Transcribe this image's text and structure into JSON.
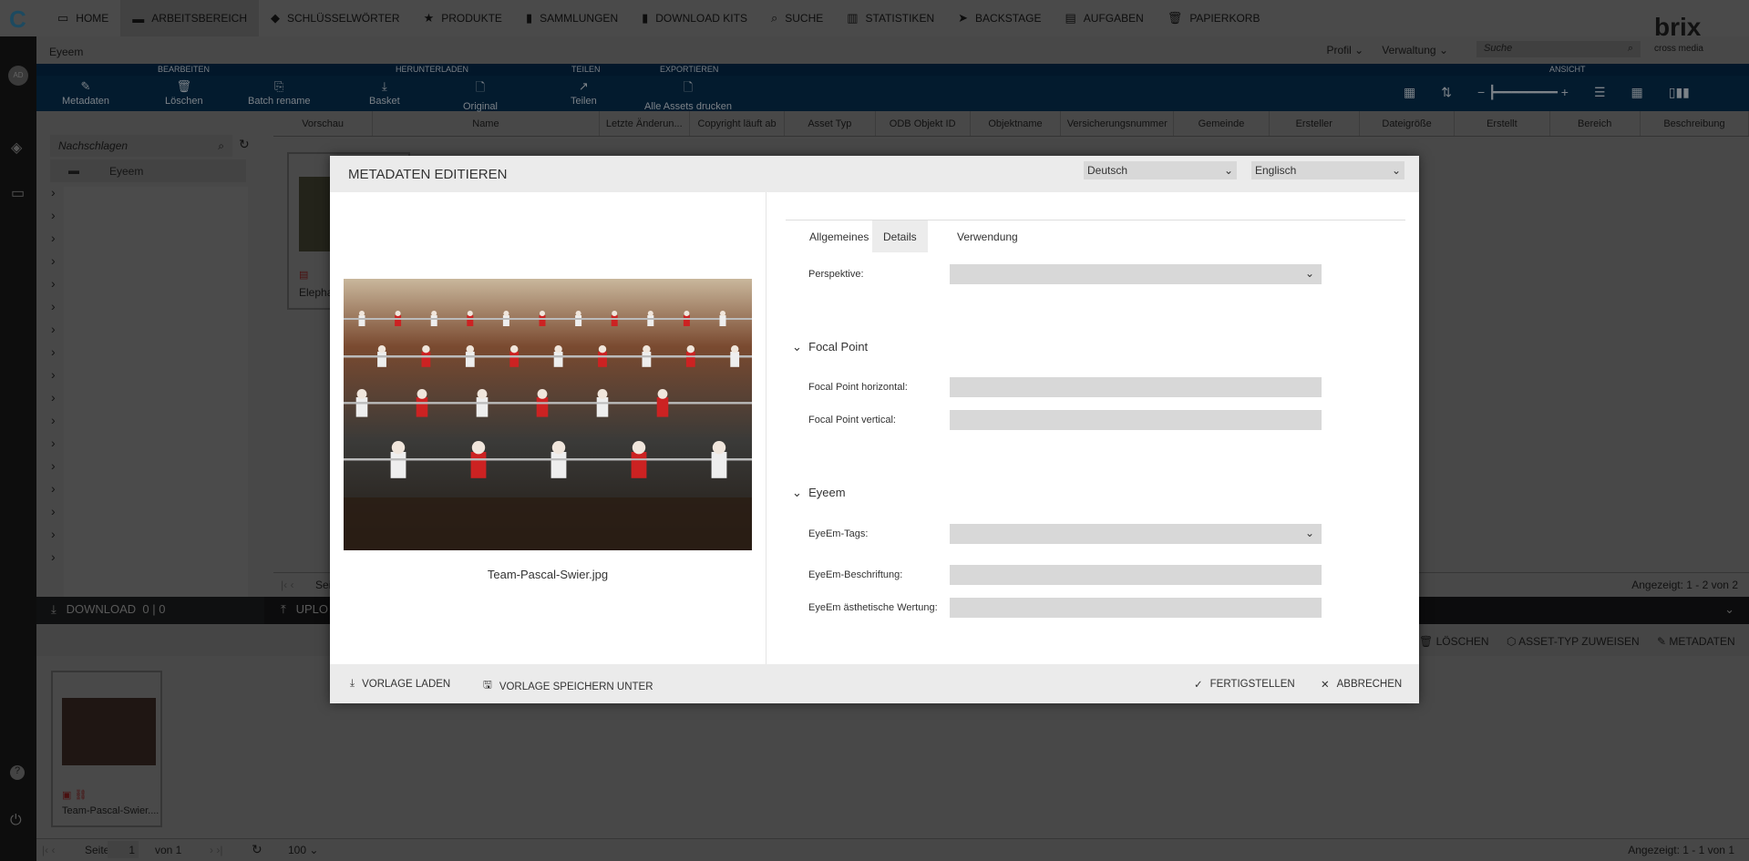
{
  "nav": {
    "items": [
      {
        "label": "HOME",
        "icon": "monitor-icon"
      },
      {
        "label": "ARBEITSBEREICH",
        "icon": "folder-icon",
        "active": true
      },
      {
        "label": "SCHLÜSSELWÖRTER",
        "icon": "tag-icon"
      },
      {
        "label": "PRODUKTE",
        "icon": "star-icon"
      },
      {
        "label": "SAMMLUNGEN",
        "icon": "briefcase-icon"
      },
      {
        "label": "DOWNLOAD KITS",
        "icon": "briefcase-icon"
      },
      {
        "label": "SUCHE",
        "icon": "search-icon"
      },
      {
        "label": "STATISTIKEN",
        "icon": "bar-chart-icon"
      },
      {
        "label": "BACKSTAGE",
        "icon": "send-icon"
      },
      {
        "label": "AUFGABEN",
        "icon": "clipboard-icon"
      },
      {
        "label": "PAPIERKORB",
        "icon": "trash-icon"
      }
    ],
    "profile": "Profil",
    "admin": "Verwaltung",
    "search_placeholder": "Suche",
    "brand": "brix",
    "brand_sub": "cross media",
    "avatar": "AD"
  },
  "breadcrumb": "Eyeem",
  "ribbon": {
    "groups": [
      "BEARBEITEN",
      "HERUNTERLADEN",
      "TEILEN",
      "EXPORTIEREN",
      "ANSICHT"
    ],
    "buttons": [
      "Metadaten",
      "Löschen",
      "Batch rename",
      "Basket",
      "Original",
      "Teilen",
      "Alle Assets drucken"
    ]
  },
  "columns": [
    "Vorschau",
    "Name",
    "Letzte Änderun...",
    "Copyright läuft ab",
    "Asset Typ",
    "ODB Objekt ID",
    "Objektname",
    "Versicherungsnummer",
    "Gemeinde",
    "Ersteller",
    "Dateigröße",
    "Erstellt",
    "Bereich",
    "Beschreibung"
  ],
  "left_panel": {
    "search_placeholder": "Nachschlagen",
    "root": "Eyeem"
  },
  "grid": {
    "card_name": "Elepha",
    "pager_label": "Sei",
    "shown": "Angezeigt: 1 - 2 von 2"
  },
  "bottom": {
    "download": "DOWNLOAD",
    "download_count": "0 | 0",
    "upload": "UPLO",
    "actions": [
      "LÖSCHEN",
      "ASSET-TYP ZUWEISEN",
      "METADATEN"
    ],
    "thumb_name": "Team-Pascal-Swier....",
    "page_label": "Seite",
    "page": "1",
    "of": "von 1",
    "per_page": "100",
    "shown": "Angezeigt: 1 - 1 von 1"
  },
  "modal": {
    "title": "METADATEN EDITIEREN",
    "filename": "Team-Pascal-Swier.jpg",
    "lang1": "Deutsch",
    "lang2": "Englisch",
    "tabs": [
      "Allgemeines",
      "Details",
      "Verwendung"
    ],
    "active_tab": "Details",
    "perspektive": "Perspektive:",
    "focal_section": "Focal Point",
    "focal_h": "Focal Point horizontal:",
    "focal_v": "Focal Point vertical:",
    "eyeem_section": "Eyeem",
    "eyeem_tags": "EyeEm-Tags:",
    "eyeem_caption": "EyeEm-Beschriftung:",
    "eyeem_aesthetic": "EyeEm ästhetische Wertung:",
    "footer": {
      "load": "VORLAGE LADEN",
      "save": "VORLAGE SPEICHERN UNTER",
      "finish": "FERTIGSTELLEN",
      "cancel": "ABBRECHEN"
    }
  }
}
